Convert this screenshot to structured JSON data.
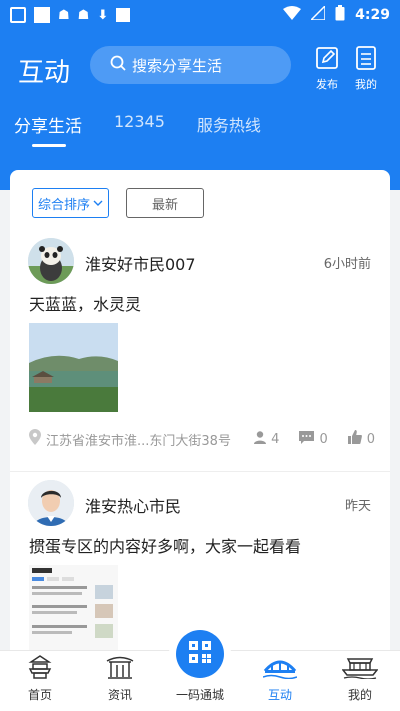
{
  "status": {
    "time": "4:29"
  },
  "header": {
    "title": "互动",
    "search_placeholder": "搜索分享生活",
    "publish_label": "发布",
    "mine_label": "我的"
  },
  "tabs": [
    {
      "label": "分享生活",
      "active": true
    },
    {
      "label": "12345",
      "active": false
    },
    {
      "label": "服务热线",
      "active": false
    }
  ],
  "filters": {
    "sort_label": "综合排序",
    "latest_label": "最新"
  },
  "posts": [
    {
      "author": "淮安好市民007",
      "time": "6小时前",
      "text": "天蓝蓝，水灵灵",
      "location": "江苏省淮安市淮...东门大街38号",
      "views": "4",
      "comments": "0",
      "likes": "0"
    },
    {
      "author": "淮安热心市民",
      "time": "昨天",
      "text": "掼蛋专区的内容好多啊，大家一起看看"
    }
  ],
  "bottom_nav": [
    {
      "label": "首页",
      "icon": "home-icon"
    },
    {
      "label": "资讯",
      "icon": "news-icon"
    },
    {
      "label": "一码通城",
      "icon": "qr-code-icon"
    },
    {
      "label": "互动",
      "icon": "bridge-icon",
      "active": true
    },
    {
      "label": "我的",
      "icon": "boat-icon"
    }
  ],
  "colors": {
    "primary": "#1d7ff2",
    "text": "#222222",
    "muted": "#999999"
  }
}
